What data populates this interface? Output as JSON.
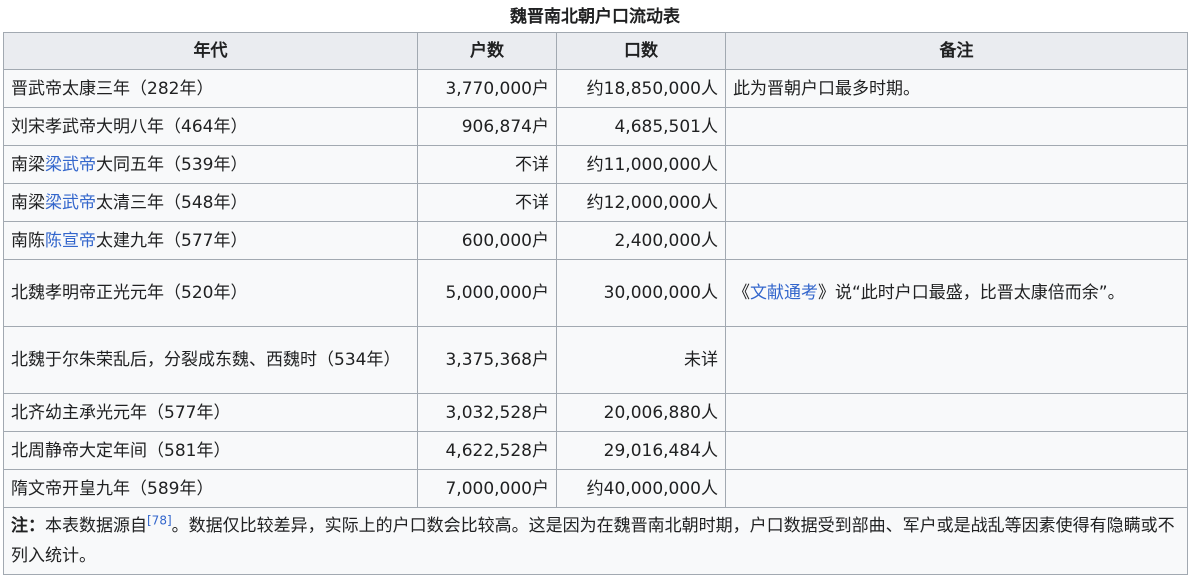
{
  "caption": "魏晋南北朝户口流动表",
  "headers": [
    "年代",
    "户数",
    "口数",
    "备注"
  ],
  "rows": [
    {
      "era": [
        "晋武帝太康三年（282年）"
      ],
      "households": "3,770,000户",
      "population": "约18,850,000人",
      "note": [
        "此为晋朝户口最多时期。"
      ]
    },
    {
      "era": [
        "刘宋孝武帝大明八年（464年）"
      ],
      "households": "906,874户",
      "population": "4,685,501人",
      "note": [
        ""
      ]
    },
    {
      "era": [
        "南梁",
        "梁武帝",
        "大同五年（539年）"
      ],
      "households": "不详",
      "population": "约11,000,000人",
      "note": [
        ""
      ]
    },
    {
      "era": [
        "南梁",
        "梁武帝",
        "太清三年（548年）"
      ],
      "households": "不详",
      "population": "约12,000,000人",
      "note": [
        ""
      ]
    },
    {
      "era": [
        "南陈",
        "陈宣帝",
        "太建九年（577年）"
      ],
      "households": "600,000户",
      "population": "2,400,000人",
      "note": [
        ""
      ]
    },
    {
      "era": [
        "北魏孝明帝正光元年（520年）"
      ],
      "households": "5,000,000户",
      "population": "30,000,000人",
      "note": [
        "《",
        "文献通考",
        "》说“此时户口最盛，比晋太康倍而余”。"
      ]
    },
    {
      "era": [
        "北魏于尔朱荣乱后，分裂成东魏、西魏时（534年）"
      ],
      "households": "3,375,368户",
      "population": "未详",
      "note": [
        ""
      ]
    },
    {
      "era": [
        "北齐幼主承光元年（577年）"
      ],
      "households": "3,032,528户",
      "population": "20,006,880人",
      "note": [
        ""
      ]
    },
    {
      "era": [
        "北周静帝大定年间（581年）"
      ],
      "households": "4,622,528户",
      "population": "29,016,484人",
      "note": [
        ""
      ]
    },
    {
      "era": [
        "隋文帝开皇九年（589年）"
      ],
      "households": "7,000,000户",
      "population": "约40,000,000人",
      "note": [
        ""
      ]
    }
  ],
  "footnote": {
    "label": "注：",
    "pre": "本表数据源自",
    "ref": "[78]",
    "post": "。数据仅比较差异，实际上的户口数会比较高。这是因为在魏晋南北朝时期，户口数据受到部曲、军户或是战乱等因素使得有隐瞒或不列入统计。"
  },
  "colors": {
    "link": "#3366cc",
    "header_bg": "#eaecf0",
    "cell_bg": "#f8f9fa",
    "border": "#a2a9b1"
  }
}
